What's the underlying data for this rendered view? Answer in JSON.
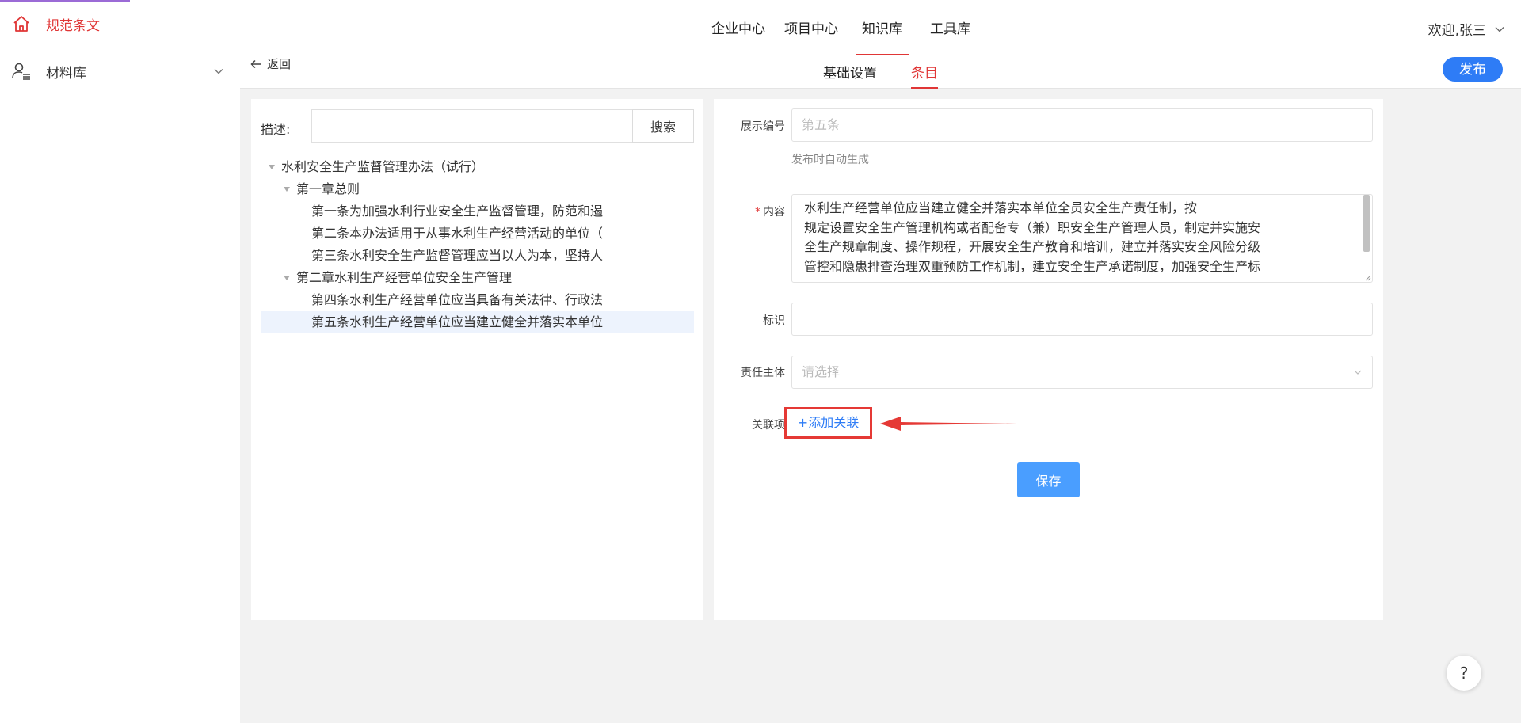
{
  "sidebar": {
    "items": [
      {
        "label": "规范条文",
        "icon": "home-icon"
      },
      {
        "label": "材料库",
        "icon": "user-list-icon"
      }
    ]
  },
  "header": {
    "tabs": [
      "企业中心",
      "项目中心",
      "知识库",
      "工具库"
    ],
    "active_tab": "知识库",
    "welcome": "欢迎,张三",
    "back_label": "返回",
    "sub_tabs": [
      "基础设置",
      "条目"
    ],
    "active_sub_tab": "条目",
    "publish_label": "发布"
  },
  "search": {
    "label": "描述:",
    "value": "",
    "button_label": "搜索"
  },
  "tree": {
    "root": "水利安全生产监督管理办法（试行）",
    "chapters": [
      {
        "title": "第一章总则",
        "items": [
          "第一条为加强水利行业安全生产监督管理，防范和遏",
          "第二条本办法适用于从事水利生产经营活动的单位（",
          "第三条水利安全生产监督管理应当以人为本，坚持人"
        ]
      },
      {
        "title": "第二章水利生产经营单位安全生产管理",
        "items": [
          "第四条水利生产经营单位应当具备有关法律、行政法",
          "第五条水利生产经营单位应当建立健全并落实本单位"
        ]
      }
    ],
    "selected": "第五条水利生产经营单位应当建立健全并落实本单位"
  },
  "form": {
    "display_no_label": "展示编号",
    "display_no_value": "第五条",
    "display_no_hint": "发布时自动生成",
    "content_label": "内容",
    "content_lines": [
      "水利生产经营单位应当建立健全并落实本单位全员安全生产责任制，按",
      "规定设置安全生产管理机构或者配备专（兼）职安全生产管理人员，制定并实施安",
      "全生产规章制度、操作规程，开展安全生产教育和培训，建立并落实安全风险分级",
      "管控和隐患排查治理双重预防工作机制，建立安全生产承诺制度，加强安全生产标"
    ],
    "tag_label": "标识",
    "tag_value": "",
    "subject_label": "责任主体",
    "subject_placeholder": "请选择",
    "relation_label": "关联项",
    "add_relation_label": "+添加关联",
    "save_label": "保存"
  },
  "help_label": "?",
  "colors": {
    "accent_red": "#e03636",
    "primary_blue": "#2e7cf6",
    "save_blue": "#4a9eff",
    "annotation_red": "#e53935"
  }
}
